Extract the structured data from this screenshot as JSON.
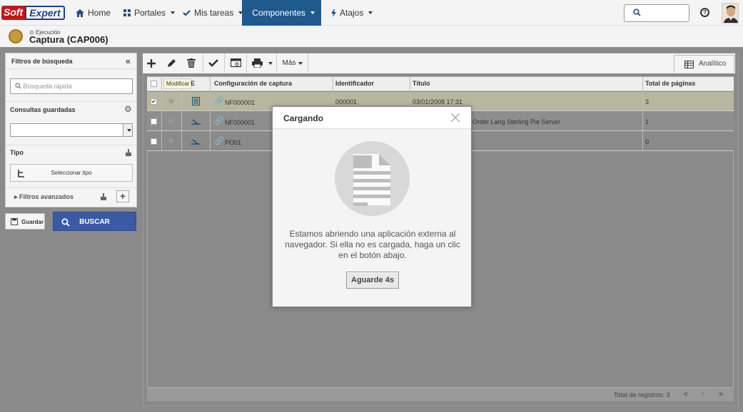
{
  "brand": {
    "soft": "Soft",
    "expert": "Expert"
  },
  "nav": {
    "home": "Home",
    "portales": "Portales",
    "mis_tareas": "Mis tareas",
    "componentes": "Componentes",
    "atajos": "Atajos"
  },
  "page": {
    "section": "Ejecución",
    "title": "Captura (CAP006)"
  },
  "sidebar": {
    "title": "Filtros de búsqueda",
    "quick_placeholder": "Búsqueda rápida",
    "saved_queries": "Consultas guardadas",
    "type_label": "Tipo",
    "select_type": "Seleccionar tipo",
    "advanced": "Filtros avanzados",
    "save": "Guardar",
    "search": "BUSCAR"
  },
  "toolbar": {
    "mas": "Más",
    "analitico": "Analítico",
    "tooltip": "Modificar"
  },
  "table": {
    "columns": [
      "E",
      "Configuración de captura",
      "Identificador",
      "Título",
      "Total de páginas"
    ],
    "rows": [
      {
        "config": "NF000001",
        "id": "000001",
        "titulo": "03/01/2008 17:31",
        "pages": "3",
        "checked": true,
        "selected": true
      },
      {
        "config": "NF000001",
        "id": "",
        "titulo": "Order Lang Sterling Pie Server",
        "pages": "1",
        "checked": false,
        "selected": false
      },
      {
        "config": "PO01",
        "id": "",
        "titulo": "",
        "pages": "0",
        "checked": false,
        "selected": false
      }
    ],
    "footer": "Total de registros: 3"
  },
  "modal": {
    "title": "Cargando",
    "message": "Estamos abriendo una aplicación externa al navegador. Si ella no es cargada, haga un clic en el botón abajo.",
    "button": "Aguarde 4s"
  },
  "colors": {
    "active_nav": "#1e5a8e",
    "buscar": "#3b5aa5",
    "selected_row": "#f3f1d3"
  }
}
